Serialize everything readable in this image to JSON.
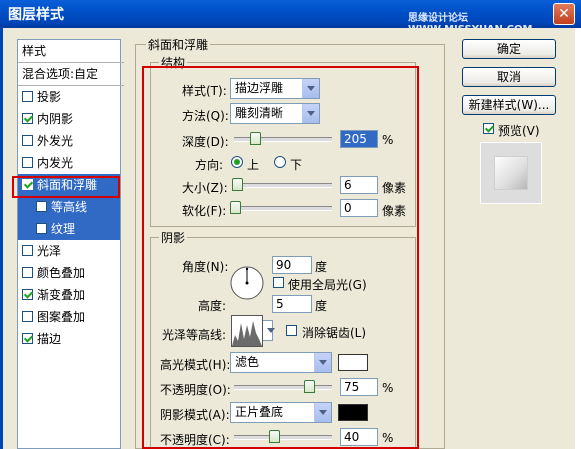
{
  "window": {
    "title": "图层样式",
    "watermark": "思缘设计论坛 WWW.MISSYUAN.COM",
    "close_glyph": "✕"
  },
  "style_list": {
    "header": "样式",
    "blend_options": "混合选项:自定",
    "items": [
      {
        "label": "投影",
        "checked": false
      },
      {
        "label": "内阴影",
        "checked": true
      },
      {
        "label": "外发光",
        "checked": false
      },
      {
        "label": "内发光",
        "checked": false
      },
      {
        "label": "斜面和浮雕",
        "checked": true,
        "selected": true
      },
      {
        "label": "等高线",
        "checked": false,
        "sub": true
      },
      {
        "label": "纹理",
        "checked": false,
        "sub": true
      },
      {
        "label": "光泽",
        "checked": false
      },
      {
        "label": "颜色叠加",
        "checked": false
      },
      {
        "label": "渐变叠加",
        "checked": true
      },
      {
        "label": "图案叠加",
        "checked": false
      },
      {
        "label": "描边",
        "checked": true
      }
    ]
  },
  "bevel": {
    "group_title": "斜面和浮雕",
    "structure": {
      "title": "结构",
      "style_label": "样式(T):",
      "style_value": "描边浮雕",
      "technique_label": "方法(Q):",
      "technique_value": "雕刻清晰",
      "depth_label": "深度(D):",
      "depth_value": "205",
      "depth_unit": "%",
      "direction_label": "方向:",
      "dir_up": "上",
      "dir_down": "下",
      "size_label": "大小(Z):",
      "size_value": "6",
      "size_unit": "像素",
      "soften_label": "软化(F):",
      "soften_value": "0",
      "soften_unit": "像素"
    },
    "shading": {
      "title": "阴影",
      "angle_label": "角度(N):",
      "angle_value": "90",
      "angle_unit": "度",
      "global_light": "使用全局光(G)",
      "altitude_label": "高度:",
      "altitude_value": "5",
      "altitude_unit": "度",
      "gloss_label": "光泽等高线:",
      "anti_alias": "消除锯齿(L)",
      "highlight_mode_label": "高光模式(H):",
      "highlight_mode_value": "滤色",
      "highlight_color": "#ffffff",
      "opacity1_label": "不透明度(O):",
      "opacity1_value": "75",
      "opacity1_unit": "%",
      "shadow_mode_label": "阴影模式(A):",
      "shadow_mode_value": "正片叠底",
      "shadow_color": "#000000",
      "opacity2_label": "不透明度(C):",
      "opacity2_value": "40",
      "opacity2_unit": "%"
    }
  },
  "buttons": {
    "ok": "确定",
    "cancel": "取消",
    "new_style": "新建样式(W)...",
    "preview": "预览(V)"
  }
}
